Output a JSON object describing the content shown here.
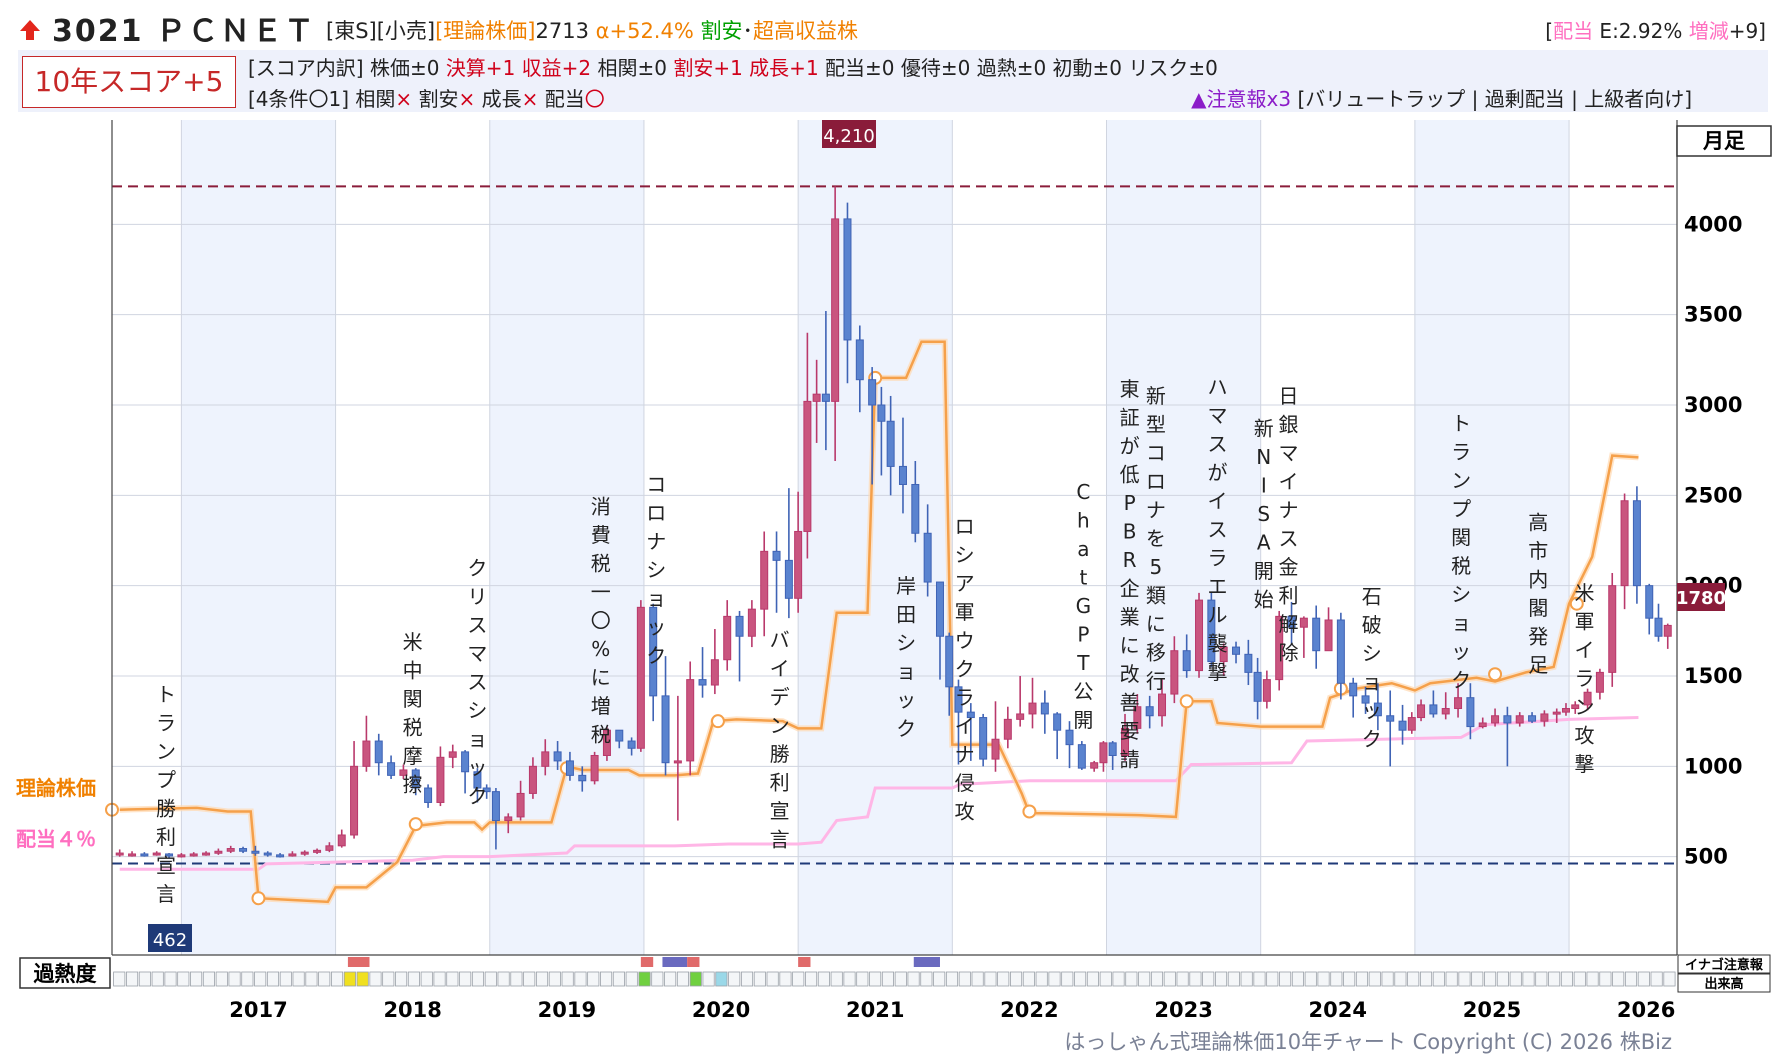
{
  "header": {
    "ticker": "3021 ＰＣＮＥＴ",
    "market": "[東S][小売]",
    "theory_label": "[理論株価]",
    "theory_value": "2713",
    "alpha": "α+52.4%",
    "cheap": "割安",
    "separator": "･",
    "profit": "超高収益株",
    "div_open": "[",
    "div_label": "配当",
    "div_rate": " E:2.92% ",
    "div_change_label": "増減",
    "div_change": "+9]"
  },
  "score": {
    "box": "10年スコア+5",
    "breakdown_prefix": "[スコア内訳] 株価±0 ",
    "kessan": "決算+1 収益+2",
    "mid1": " 相関±0 ",
    "wariyasu": "割安+1 成長+1",
    "rest": " 配当±0 優待±0 過熱±0 初動±0 リスク±0",
    "cond_prefix": "[4条件〇1] ",
    "c1": "相関",
    "c2": "割安",
    "c3": "成長",
    "c4": "配当",
    "x_mark": "×",
    "o_mark": "〇",
    "warn_prefix": "▲注意報x3",
    "warn_items": " [バリュートラップ | 過剰配当 | 上級者向け]"
  },
  "chart_data": {
    "type": "candlestick",
    "period": "月足",
    "ylim": [
      0,
      4400
    ],
    "yticks": [
      500,
      1000,
      1500,
      2000,
      2500,
      3000,
      3500,
      4000
    ],
    "years": [
      "2017",
      "2018",
      "2019",
      "2020",
      "2021",
      "2022",
      "2023",
      "2024",
      "2025",
      "2026"
    ],
    "high_label": "4,210",
    "low_label": "462",
    "last_label": "1780",
    "theory_line_label": "理論株価",
    "dividend_line_label": "配当４％",
    "heat_label": "過熱度",
    "inago_label": "イナゴ注意報",
    "volume_label": "出来高",
    "annotations": [
      {
        "t": 2016.9,
        "y": 1360,
        "text": "トランプ勝利宣言"
      },
      {
        "t": 2018.5,
        "y": 1650,
        "text": "米中関税摩擦"
      },
      {
        "t": 2018.92,
        "y": 2060,
        "text": "クリスマスショック"
      },
      {
        "t": 2019.72,
        "y": 2400,
        "text": "消費税一〇%に増税"
      },
      {
        "t": 2020.08,
        "y": 2520,
        "text": "コロナショック"
      },
      {
        "t": 2020.88,
        "y": 1660,
        "text": "バイデン勝利宣言"
      },
      {
        "t": 2021.7,
        "y": 1960,
        "text": "岸田ショック"
      },
      {
        "t": 2022.08,
        "y": 2290,
        "text": "ロシア軍ウクライナ侵攻"
      },
      {
        "t": 2022.85,
        "y": 2480,
        "text": "ChatGPT公開"
      },
      {
        "t": 2023.15,
        "y": 3050,
        "text": "東証が低PBR企業に改善要請"
      },
      {
        "t": 2023.32,
        "y": 3010,
        "text": "新型コロナを5類に移行"
      },
      {
        "t": 2023.72,
        "y": 3060,
        "text": "ハマスがイスラエル襲撃"
      },
      {
        "t": 2024.02,
        "y": 2830,
        "text": "新NISA開始"
      },
      {
        "t": 2024.18,
        "y": 3010,
        "text": "日銀マイナス金利解除"
      },
      {
        "t": 2024.72,
        "y": 1900,
        "text": "石破ショック"
      },
      {
        "t": 2025.3,
        "y": 2860,
        "text": "トランプ関税ショック"
      },
      {
        "t": 2025.8,
        "y": 2310,
        "text": "高市内閣発足"
      },
      {
        "t": 2026.1,
        "y": 1920,
        "text": "米軍イラン攻撃"
      }
    ],
    "theory_series": [
      [
        2016.6,
        760
      ],
      [
        2017.1,
        770
      ],
      [
        2017.3,
        750
      ],
      [
        2017.45,
        750
      ],
      [
        2017.5,
        270
      ],
      [
        2017.72,
        260
      ],
      [
        2017.95,
        250
      ],
      [
        2018.0,
        330
      ],
      [
        2018.15,
        330
      ],
      [
        2018.2,
        330
      ],
      [
        2018.4,
        470
      ],
      [
        2018.52,
        670
      ],
      [
        2018.72,
        690
      ],
      [
        2018.9,
        690
      ],
      [
        2018.95,
        650
      ],
      [
        2019.0,
        690
      ],
      [
        2019.4,
        690
      ],
      [
        2019.5,
        1000
      ],
      [
        2019.6,
        980
      ],
      [
        2019.9,
        980
      ],
      [
        2019.97,
        950
      ],
      [
        2020.2,
        950
      ],
      [
        2020.35,
        960
      ],
      [
        2020.45,
        1250
      ],
      [
        2020.6,
        1260
      ],
      [
        2020.9,
        1250
      ],
      [
        2021.0,
        1210
      ],
      [
        2021.15,
        1210
      ],
      [
        2021.25,
        1850
      ],
      [
        2021.45,
        1850
      ],
      [
        2021.5,
        3150
      ],
      [
        2021.7,
        3150
      ],
      [
        2021.8,
        3350
      ],
      [
        2021.95,
        3350
      ],
      [
        2022.0,
        1120
      ],
      [
        2022.3,
        1120
      ],
      [
        2022.45,
        850
      ],
      [
        2022.5,
        740
      ],
      [
        2022.6,
        740
      ],
      [
        2023.2,
        730
      ],
      [
        2023.45,
        720
      ],
      [
        2023.52,
        1360
      ],
      [
        2023.68,
        1360
      ],
      [
        2023.72,
        1240
      ],
      [
        2024.0,
        1220
      ],
      [
        2024.4,
        1220
      ],
      [
        2024.45,
        1380
      ],
      [
        2024.62,
        1430
      ],
      [
        2024.85,
        1460
      ],
      [
        2025.0,
        1420
      ],
      [
        2025.1,
        1460
      ],
      [
        2025.4,
        1490
      ],
      [
        2025.52,
        1470
      ],
      [
        2025.72,
        1520
      ],
      [
        2025.9,
        1550
      ],
      [
        2026.0,
        1900
      ],
      [
        2026.15,
        2160
      ],
      [
        2026.28,
        2720
      ],
      [
        2026.45,
        2710
      ]
    ],
    "theory_markers": [
      [
        2016.55,
        760
      ],
      [
        2017.5,
        270
      ],
      [
        2018.52,
        680
      ],
      [
        2019.5,
        990
      ],
      [
        2020.48,
        1250
      ],
      [
        2021.5,
        3150
      ],
      [
        2022.5,
        750
      ],
      [
        2023.52,
        1360
      ],
      [
        2024.52,
        1430
      ],
      [
        2025.52,
        1510
      ],
      [
        2026.05,
        1900
      ]
    ],
    "dividend_series": [
      [
        2016.6,
        430
      ],
      [
        2017.5,
        430
      ],
      [
        2017.55,
        460
      ],
      [
        2018.0,
        470
      ],
      [
        2018.5,
        480
      ],
      [
        2018.7,
        500
      ],
      [
        2019.0,
        500
      ],
      [
        2019.5,
        520
      ],
      [
        2019.55,
        560
      ],
      [
        2020.2,
        560
      ],
      [
        2020.55,
        570
      ],
      [
        2021.0,
        570
      ],
      [
        2021.15,
        580
      ],
      [
        2021.25,
        700
      ],
      [
        2021.45,
        720
      ],
      [
        2021.5,
        880
      ],
      [
        2022.0,
        880
      ],
      [
        2022.05,
        900
      ],
      [
        2022.5,
        920
      ],
      [
        2023.45,
        920
      ],
      [
        2023.55,
        1010
      ],
      [
        2023.6,
        1010
      ],
      [
        2024.2,
        1020
      ],
      [
        2024.3,
        1140
      ],
      [
        2025.3,
        1160
      ],
      [
        2025.45,
        1230
      ],
      [
        2026.0,
        1260
      ],
      [
        2026.45,
        1270
      ]
    ],
    "candles": [
      [
        2016.6,
        520,
        520,
        540,
        500
      ],
      [
        2016.68,
        510,
        515,
        530,
        500
      ],
      [
        2016.76,
        515,
        510,
        525,
        500
      ],
      [
        2016.84,
        510,
        520,
        530,
        505
      ],
      [
        2016.92,
        515,
        505,
        520,
        495
      ],
      [
        2017.0,
        505,
        510,
        520,
        495
      ],
      [
        2017.08,
        505,
        515,
        525,
        500
      ],
      [
        2017.16,
        515,
        520,
        530,
        505
      ],
      [
        2017.24,
        520,
        530,
        545,
        510
      ],
      [
        2017.32,
        530,
        545,
        560,
        520
      ],
      [
        2017.4,
        545,
        530,
        555,
        520
      ],
      [
        2017.48,
        530,
        520,
        560,
        505
      ],
      [
        2017.56,
        520,
        510,
        530,
        500
      ],
      [
        2017.64,
        510,
        505,
        520,
        495
      ],
      [
        2017.72,
        505,
        515,
        530,
        500
      ],
      [
        2017.8,
        515,
        525,
        535,
        505
      ],
      [
        2017.88,
        525,
        535,
        545,
        515
      ],
      [
        2017.96,
        535,
        560,
        580,
        525
      ],
      [
        2018.04,
        560,
        620,
        650,
        550
      ],
      [
        2018.12,
        620,
        1000,
        1140,
        600
      ],
      [
        2018.2,
        1000,
        1140,
        1280,
        970
      ],
      [
        2018.28,
        1140,
        1020,
        1180,
        950
      ],
      [
        2018.36,
        1020,
        950,
        1060,
        930
      ],
      [
        2018.44,
        950,
        980,
        1010,
        930
      ],
      [
        2018.52,
        980,
        880,
        990,
        840
      ],
      [
        2018.6,
        880,
        800,
        900,
        770
      ],
      [
        2018.68,
        800,
        1050,
        1110,
        780
      ],
      [
        2018.76,
        1050,
        1080,
        1120,
        990
      ],
      [
        2018.84,
        1080,
        970,
        1090,
        850
      ],
      [
        2018.92,
        970,
        880,
        990,
        800
      ],
      [
        2018.98,
        880,
        860,
        900,
        820
      ],
      [
        2019.04,
        860,
        700,
        880,
        540
      ],
      [
        2019.12,
        700,
        720,
        740,
        630
      ],
      [
        2019.2,
        720,
        850,
        920,
        700
      ],
      [
        2019.28,
        850,
        1000,
        1050,
        820
      ],
      [
        2019.36,
        1000,
        1080,
        1150,
        950
      ],
      [
        2019.44,
        1080,
        1030,
        1140,
        980
      ],
      [
        2019.52,
        1030,
        950,
        1080,
        920
      ],
      [
        2019.6,
        950,
        920,
        1000,
        860
      ],
      [
        2019.68,
        920,
        1060,
        1080,
        900
      ],
      [
        2019.76,
        1060,
        1200,
        1220,
        1030
      ],
      [
        2019.84,
        1200,
        1140,
        1200,
        1100
      ],
      [
        2019.92,
        1140,
        1100,
        1160,
        1060
      ],
      [
        2019.98,
        1100,
        1880,
        1920,
        1080
      ],
      [
        2020.06,
        1880,
        1390,
        1900,
        1250
      ],
      [
        2020.14,
        1390,
        1020,
        1610,
        950
      ],
      [
        2020.22,
        1020,
        1030,
        1390,
        700
      ],
      [
        2020.3,
        1030,
        1480,
        1580,
        950
      ],
      [
        2020.38,
        1480,
        1450,
        1660,
        1380
      ],
      [
        2020.46,
        1450,
        1590,
        1760,
        1400
      ],
      [
        2020.54,
        1590,
        1830,
        1920,
        1530
      ],
      [
        2020.62,
        1830,
        1720,
        1860,
        1470
      ],
      [
        2020.7,
        1720,
        1870,
        1920,
        1660
      ],
      [
        2020.78,
        1870,
        2190,
        2300,
        1720
      ],
      [
        2020.86,
        2190,
        2140,
        2300,
        1850
      ],
      [
        2020.94,
        2140,
        1930,
        2540,
        1820
      ],
      [
        2021.0,
        1930,
        2300,
        2520,
        1850
      ],
      [
        2021.06,
        2300,
        3020,
        3400,
        2150
      ],
      [
        2021.12,
        3020,
        3060,
        3250,
        2790
      ],
      [
        2021.18,
        3060,
        3020,
        3520,
        2750
      ],
      [
        2021.24,
        3020,
        4030,
        4210,
        2690
      ],
      [
        2021.32,
        4030,
        3360,
        4120,
        3120
      ],
      [
        2021.4,
        3360,
        3140,
        3440,
        2960
      ],
      [
        2021.48,
        3140,
        3000,
        3210,
        2560
      ],
      [
        2021.54,
        3000,
        2910,
        3100,
        2610
      ],
      [
        2021.6,
        2910,
        2660,
        3050,
        2500
      ],
      [
        2021.68,
        2660,
        2560,
        2930,
        2400
      ],
      [
        2021.76,
        2560,
        2290,
        2690,
        2240
      ],
      [
        2021.84,
        2290,
        2020,
        2450,
        1940
      ],
      [
        2021.92,
        2020,
        1720,
        2020,
        1480
      ],
      [
        2021.98,
        1720,
        1440,
        1740,
        1280
      ],
      [
        2022.04,
        1440,
        1300,
        1480,
        1010
      ],
      [
        2022.12,
        1300,
        1270,
        1350,
        1030
      ],
      [
        2022.2,
        1270,
        1040,
        1290,
        1000
      ],
      [
        2022.28,
        1040,
        1150,
        1360,
        970
      ],
      [
        2022.36,
        1150,
        1260,
        1330,
        1100
      ],
      [
        2022.44,
        1260,
        1290,
        1500,
        1220
      ],
      [
        2022.52,
        1290,
        1350,
        1490,
        1210
      ],
      [
        2022.6,
        1350,
        1290,
        1420,
        1180
      ],
      [
        2022.68,
        1290,
        1200,
        1300,
        1040
      ],
      [
        2022.76,
        1200,
        1120,
        1250,
        990
      ],
      [
        2022.84,
        1120,
        990,
        1140,
        980
      ],
      [
        2022.92,
        990,
        1020,
        1030,
        970
      ],
      [
        2022.98,
        1020,
        1130,
        1140,
        970
      ],
      [
        2023.04,
        1130,
        1060,
        1140,
        980
      ],
      [
        2023.12,
        1060,
        1210,
        1290,
        1030
      ],
      [
        2023.2,
        1210,
        1330,
        1400,
        1180
      ],
      [
        2023.28,
        1330,
        1280,
        1390,
        1210
      ],
      [
        2023.36,
        1280,
        1400,
        1480,
        1220
      ],
      [
        2023.44,
        1400,
        1640,
        1720,
        1350
      ],
      [
        2023.52,
        1640,
        1530,
        1730,
        1490
      ],
      [
        2023.6,
        1530,
        1920,
        1960,
        1490
      ],
      [
        2023.68,
        1920,
        1580,
        1960,
        1550
      ],
      [
        2023.76,
        1580,
        1660,
        1680,
        1500
      ],
      [
        2023.84,
        1660,
        1620,
        1690,
        1570
      ],
      [
        2023.92,
        1620,
        1520,
        1700,
        1450
      ],
      [
        2023.98,
        1520,
        1360,
        1600,
        1260
      ],
      [
        2024.04,
        1360,
        1480,
        1530,
        1320
      ],
      [
        2024.12,
        1480,
        1830,
        1860,
        1420
      ],
      [
        2024.2,
        1830,
        1770,
        1910,
        1670
      ],
      [
        2024.28,
        1770,
        1820,
        1830,
        1600
      ],
      [
        2024.36,
        1820,
        1640,
        1890,
        1540
      ],
      [
        2024.44,
        1640,
        1810,
        1880,
        1650
      ],
      [
        2024.52,
        1810,
        1460,
        1850,
        1370
      ],
      [
        2024.6,
        1460,
        1390,
        1490,
        1270
      ],
      [
        2024.68,
        1390,
        1350,
        1440,
        1290
      ],
      [
        2024.76,
        1350,
        1280,
        1460,
        1200
      ],
      [
        2024.84,
        1280,
        1250,
        1420,
        1000
      ],
      [
        2024.92,
        1250,
        1200,
        1340,
        1120
      ],
      [
        2024.98,
        1200,
        1270,
        1300,
        1180
      ],
      [
        2025.04,
        1270,
        1340,
        1370,
        1250
      ],
      [
        2025.12,
        1340,
        1290,
        1420,
        1270
      ],
      [
        2025.2,
        1290,
        1320,
        1410,
        1260
      ],
      [
        2025.28,
        1320,
        1380,
        1460,
        1270
      ],
      [
        2025.36,
        1380,
        1220,
        1460,
        1150
      ],
      [
        2025.44,
        1220,
        1240,
        1270,
        1210
      ],
      [
        2025.52,
        1240,
        1280,
        1320,
        1220
      ],
      [
        2025.6,
        1280,
        1240,
        1330,
        1000
      ],
      [
        2025.68,
        1240,
        1280,
        1300,
        1220
      ],
      [
        2025.76,
        1280,
        1250,
        1300,
        1240
      ],
      [
        2025.84,
        1250,
        1290,
        1310,
        1220
      ],
      [
        2025.92,
        1290,
        1300,
        1320,
        1240
      ],
      [
        2025.98,
        1300,
        1320,
        1350,
        1280
      ],
      [
        2026.04,
        1320,
        1340,
        1360,
        1290
      ],
      [
        2026.12,
        1340,
        1410,
        1430,
        1310
      ],
      [
        2026.2,
        1410,
        1520,
        1540,
        1370
      ],
      [
        2026.28,
        1520,
        2000,
        2070,
        1440
      ],
      [
        2026.36,
        2000,
        2470,
        2510,
        1870
      ],
      [
        2026.44,
        2470,
        2000,
        2550,
        1900
      ],
      [
        2026.52,
        2000,
        1820,
        2010,
        1730
      ],
      [
        2026.58,
        1820,
        1720,
        1900,
        1690
      ],
      [
        2026.64,
        1720,
        1780,
        1790,
        1650
      ]
    ]
  },
  "copyright": "はっしゃん式理論株価10年チャート Copyright (C) 2026 株Biz"
}
